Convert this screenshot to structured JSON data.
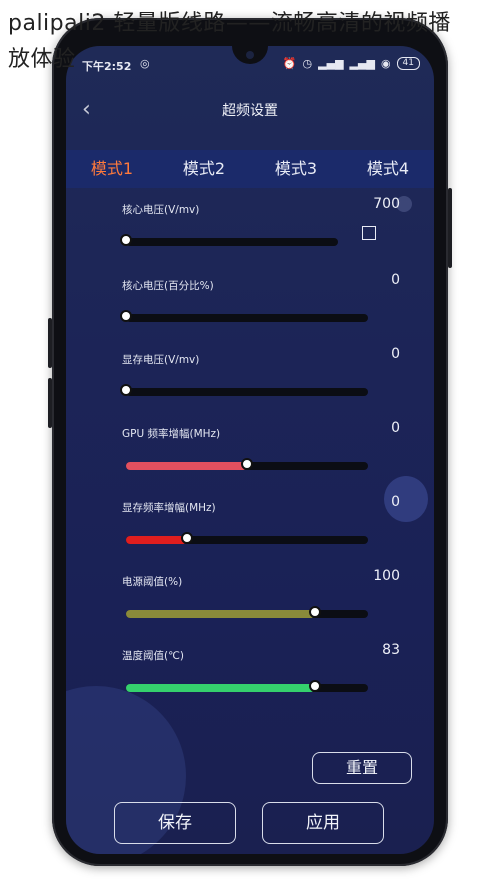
{
  "caption": {
    "line1": "palipali2 轻量版线路——流畅高清的视频播",
    "line2": "放体验"
  },
  "statusbar": {
    "time": "下午2:52",
    "left_icon": "notification-icon",
    "right_icons": [
      "alarm-icon",
      "clock-icon",
      "signal-icon",
      "signal-icon",
      "wifi-icon"
    ],
    "battery": "41"
  },
  "navbar": {
    "back_icon": "chevron-left-icon",
    "title": "超频设置"
  },
  "tabs": [
    {
      "label": "模式1",
      "active": true
    },
    {
      "label": "模式2",
      "active": false
    },
    {
      "label": "模式3",
      "active": false
    },
    {
      "label": "模式4",
      "active": false
    }
  ],
  "sliders": [
    {
      "label": "核心电压(V/mv)",
      "value": "700",
      "level": 0,
      "color": "#0b0d14"
    },
    {
      "label": "核心电压(百分比%)",
      "value": "0",
      "level": 0,
      "color": "#0b0d14"
    },
    {
      "label": "显存电压(V/mv)",
      "value": "0",
      "level": 0,
      "color": "#0b0d14"
    },
    {
      "label": "GPU 频率增幅(MHz)",
      "value": "0",
      "level": 0.5,
      "color": "#e2505f"
    },
    {
      "label": "显存频率增幅(MHz)",
      "value": "0",
      "level": 0.25,
      "color": "#e01e1e"
    },
    {
      "label": "电源阈值(%)",
      "value": "100",
      "level": 0.78,
      "color": "#8a8a3a"
    },
    {
      "label": "温度阈值(℃)",
      "value": "83",
      "level": 0.78,
      "color": "#35d16d"
    }
  ],
  "checkbox": {
    "checked": false
  },
  "buttons": {
    "reset": "重置",
    "save": "保存",
    "apply": "应用"
  },
  "colors": {
    "accent_tab": "#ff7a3c",
    "screen_bg": "#1f2a57",
    "tab_bar": "#1b2a6a"
  }
}
